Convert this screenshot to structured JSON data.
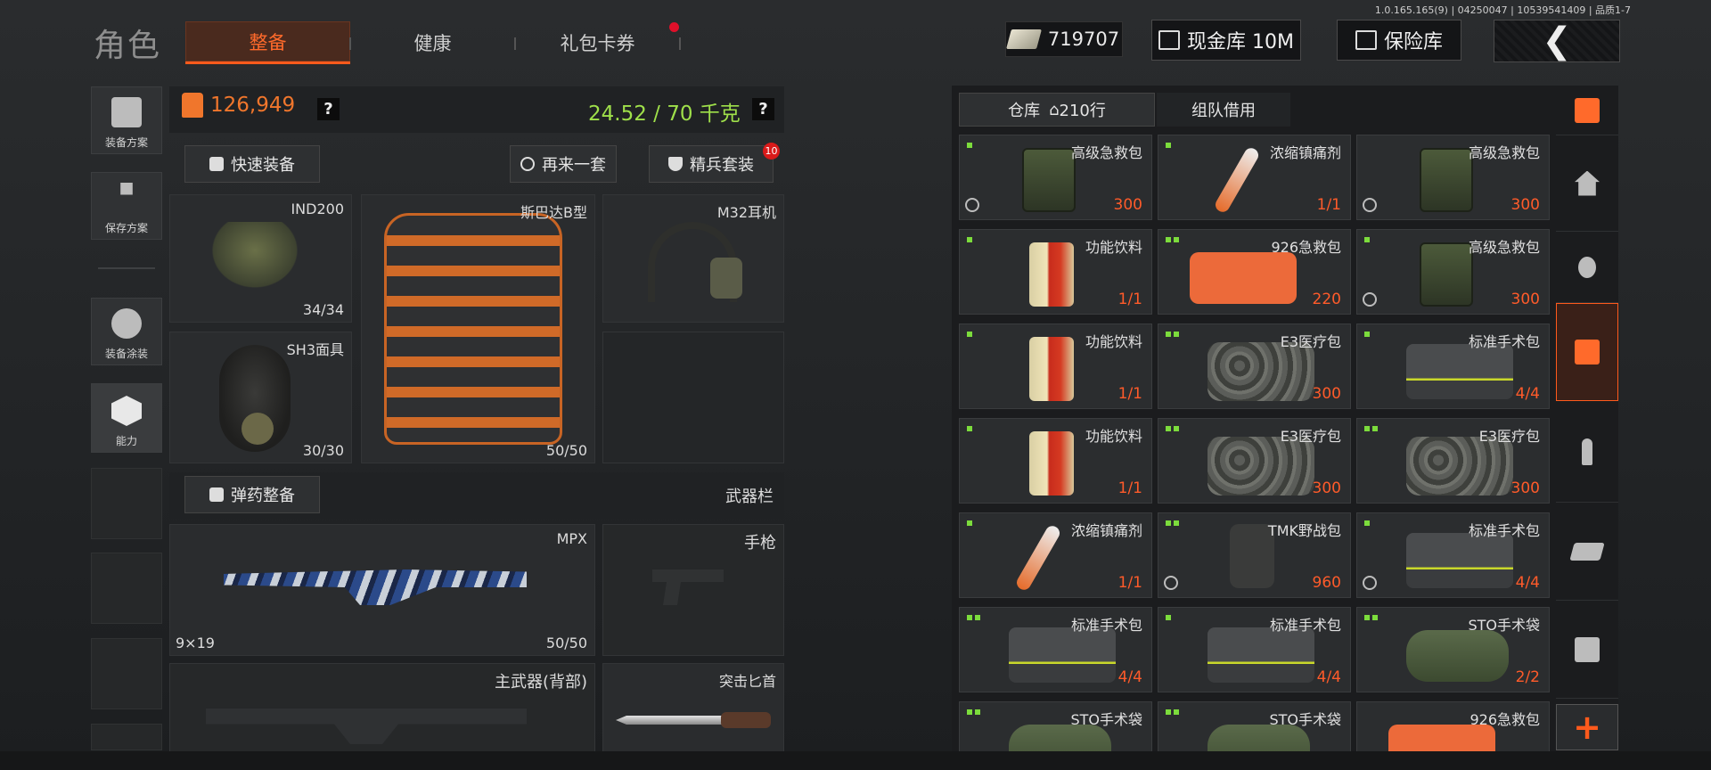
{
  "header": {
    "title": "角色",
    "version": "1.0.165.165(9) | 04250047 | 10539541409 | 品质1-7",
    "tabs": [
      {
        "label": "整备",
        "active": true
      },
      {
        "label": "健康",
        "active": false
      },
      {
        "label": "礼包卡券",
        "active": false
      }
    ],
    "cash_amount": "719707",
    "cash_vault_label": "现金库 10M",
    "safe_label": "保险库",
    "back_icon": "chevron-left-icon"
  },
  "sidebar": {
    "items": [
      {
        "label": "装备方案",
        "icon": "vest-icon"
      },
      {
        "label": "保存方案",
        "icon": "download-icon"
      },
      {
        "label": "装备涂装",
        "icon": "soldier-icon"
      },
      {
        "label": "能力",
        "icon": "hex-bolt-icon"
      }
    ]
  },
  "loadout": {
    "value": "126,949",
    "help": "?",
    "weight": "24.52 / 70 千克",
    "quick_equip": "快速装备",
    "another_set": "再来一套",
    "elite_set": "精兵套装",
    "elite_badge": "10",
    "helmet": {
      "name": "IND200",
      "durability": "34/34"
    },
    "armor": {
      "name": "斯巴达B型",
      "durability": "50/50"
    },
    "headset": {
      "name": "M32耳机"
    },
    "mask": {
      "name": "SH3面具",
      "durability": "30/30"
    },
    "ammo_btn": "弹药整备",
    "weapon_bar": "武器栏",
    "primary": {
      "name": "MPX",
      "caliber": "9×19",
      "durability": "50/50"
    },
    "pistol": {
      "name": "手枪"
    },
    "back_weapon": {
      "name": "主武器(背部)"
    },
    "knife": {
      "name": "突击匕首"
    }
  },
  "warehouse": {
    "tab_store": "仓库",
    "tab_rows": "210行",
    "tab_team": "组队借用",
    "items": [
      {
        "name": "高级急救包",
        "count": "300",
        "kind": "medkit",
        "sym": true,
        "dots": 1
      },
      {
        "name": "浓缩镇痛剂",
        "count": "1/1",
        "kind": "tube",
        "sym": false,
        "dots": 1
      },
      {
        "name": "高级急救包",
        "count": "300",
        "kind": "medkit",
        "sym": true,
        "dots": 0
      },
      {
        "name": "功能饮料",
        "count": "1/1",
        "kind": "can",
        "sym": false,
        "dots": 1
      },
      {
        "name": "926急救包",
        "count": "220",
        "kind": "pouch",
        "sym": false,
        "dots": 2
      },
      {
        "name": "高级急救包",
        "count": "300",
        "kind": "medkit",
        "sym": true,
        "dots": 1
      },
      {
        "name": "功能饮料",
        "count": "1/1",
        "kind": "can",
        "sym": false,
        "dots": 1
      },
      {
        "name": "E3医疗包",
        "count": "300",
        "kind": "camo",
        "sym": false,
        "dots": 2
      },
      {
        "name": "标准手术包",
        "count": "4/4",
        "kind": "surg",
        "sym": false,
        "dots": 1
      },
      {
        "name": "功能饮料",
        "count": "1/1",
        "kind": "can",
        "sym": false,
        "dots": 1
      },
      {
        "name": "E3医疗包",
        "count": "300",
        "kind": "camo",
        "sym": false,
        "dots": 2
      },
      {
        "name": "E3医疗包",
        "count": "300",
        "kind": "camo",
        "sym": false,
        "dots": 2
      },
      {
        "name": "浓缩镇痛剂",
        "count": "1/1",
        "kind": "tube",
        "sym": false,
        "dots": 1
      },
      {
        "name": "TMK野战包",
        "count": "960",
        "kind": "pack",
        "sym": true,
        "dots": 4
      },
      {
        "name": "标准手术包",
        "count": "4/4",
        "kind": "surg",
        "sym": true,
        "dots": 1
      },
      {
        "name": "标准手术包",
        "count": "4/4",
        "kind": "surg",
        "sym": false,
        "dots": 2
      },
      {
        "name": "标准手术包",
        "count": "4/4",
        "kind": "surg",
        "sym": false,
        "dots": 1
      },
      {
        "name": "STO手术袋",
        "count": "2/2",
        "kind": "sto",
        "sym": false,
        "dots": 2
      },
      {
        "name": "STO手术袋",
        "count": "",
        "kind": "sto",
        "sym": false,
        "dots": 2
      },
      {
        "name": "STO手术袋",
        "count": "",
        "kind": "sto",
        "sym": false,
        "dots": 2
      },
      {
        "name": "926急救包",
        "count": "",
        "kind": "pouch",
        "sym": false,
        "dots": 0
      }
    ]
  },
  "rail": {
    "icons": [
      "stack-refresh-icon",
      "home-icon",
      "grenade-icon",
      "medical-icon",
      "key-icon",
      "cash-icon",
      "box-icon"
    ],
    "plus": "+"
  },
  "colors": {
    "accent": "#ff5a1c",
    "value": "#f0762c",
    "weight": "#9fe04a",
    "count": "#ff5b2a",
    "bg": "#1e2022"
  }
}
